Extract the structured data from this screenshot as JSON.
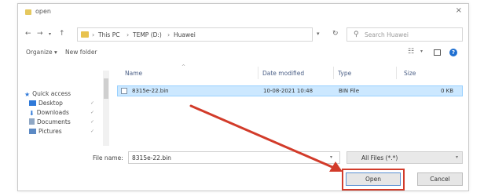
{
  "window": {
    "title": "open",
    "close_icon": "close-icon"
  },
  "address_bar": {
    "crumbs": [
      "This PC",
      "TEMP (D:)",
      "Huawei"
    ],
    "search_placeholder": "Search Huawei"
  },
  "toolbar": {
    "organize": "Organize ▾",
    "new_folder": "New folder"
  },
  "nav_pane": {
    "items": [
      {
        "label": "Quick access",
        "icon": "star-icon",
        "pinned": false
      },
      {
        "label": "Desktop",
        "icon": "desktop-icon",
        "pinned": true
      },
      {
        "label": "Downloads",
        "icon": "download-icon",
        "pinned": true
      },
      {
        "label": "Documents",
        "icon": "documents-icon",
        "pinned": true
      },
      {
        "label": "Pictures",
        "icon": "pictures-icon",
        "pinned": true
      }
    ]
  },
  "file_list": {
    "columns": [
      "Name",
      "Date modified",
      "Type",
      "Size"
    ],
    "rows": [
      {
        "name": "8315e-22.bin",
        "date": "10-08-2021 10:48",
        "type": "BIN File",
        "size": "0 KB",
        "selected": true
      }
    ]
  },
  "bottom": {
    "file_name_label": "File name:",
    "file_name_value": "8315e-22.bin",
    "filter": "All Files (*.*)",
    "open_label": "Open",
    "cancel_label": "Cancel"
  },
  "colors": {
    "selection_bg": "#cce8ff",
    "annotation_red": "#d23b2a",
    "help_blue": "#1f6fd1"
  }
}
